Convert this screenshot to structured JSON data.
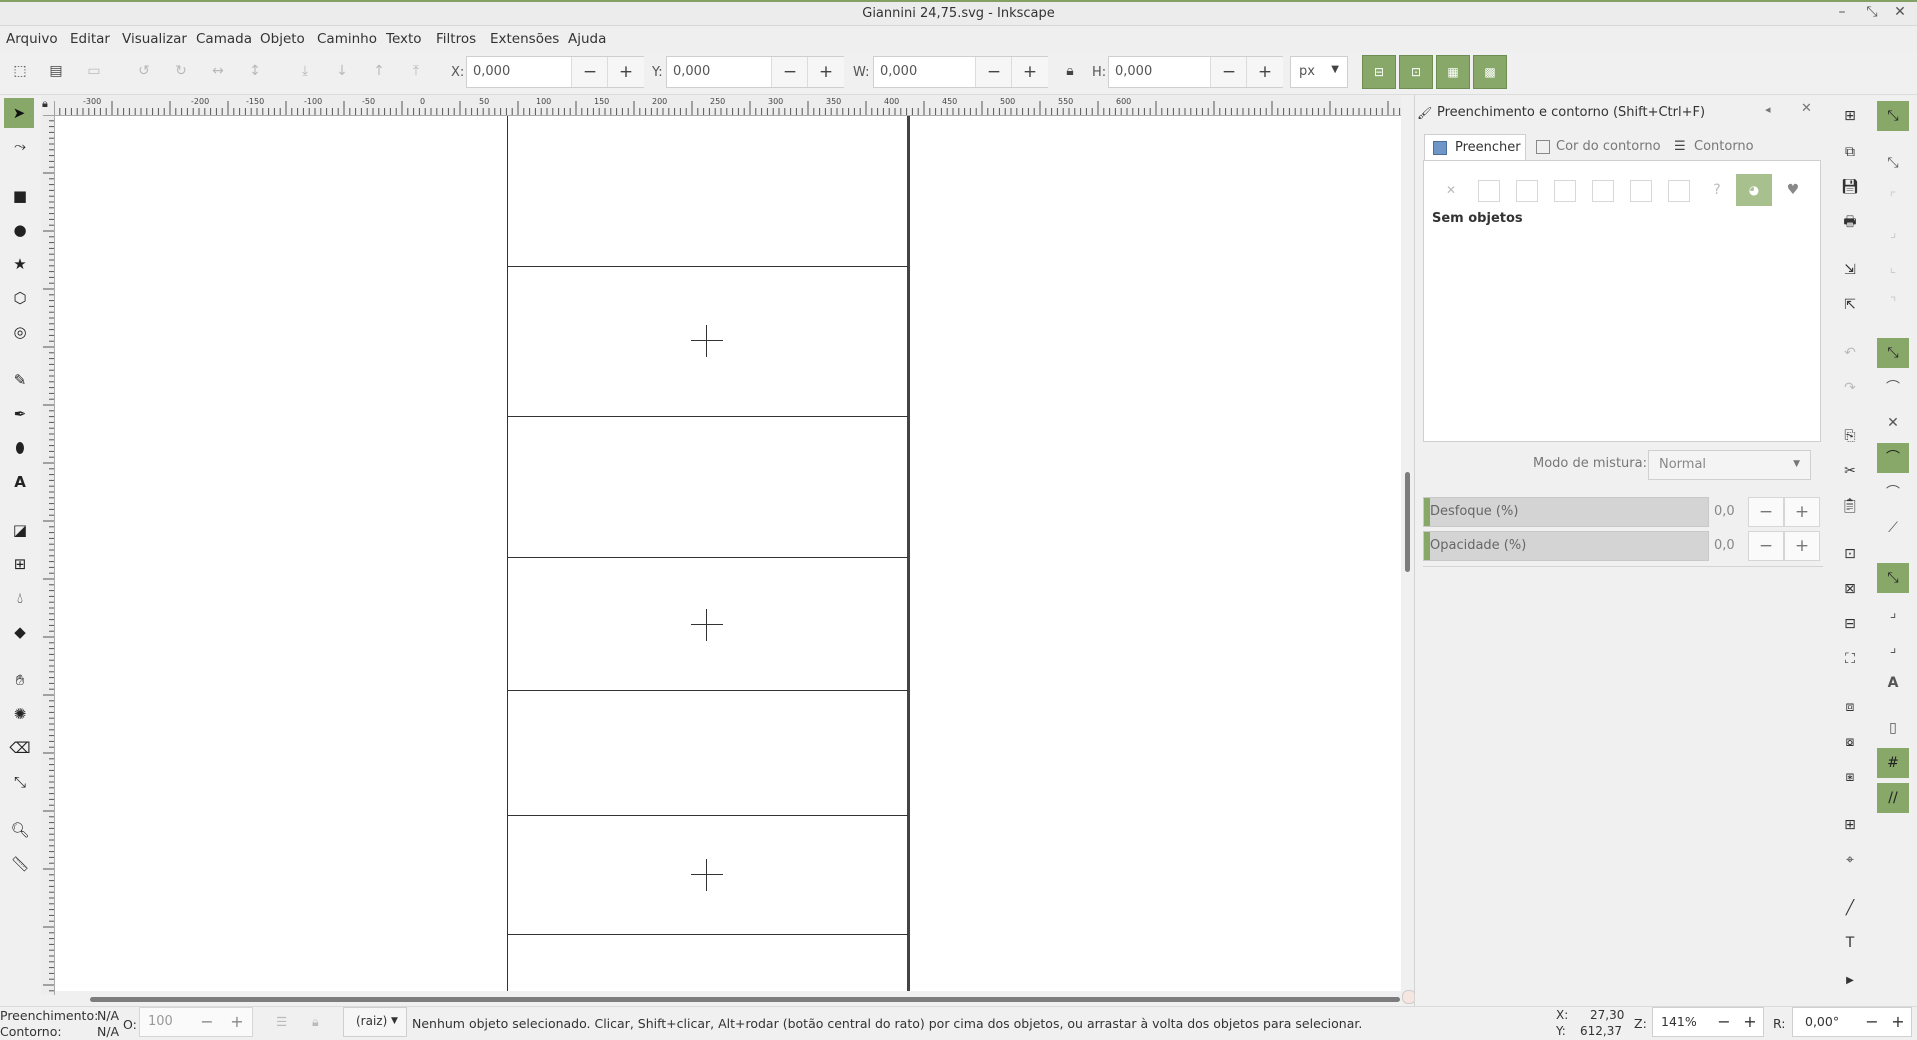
{
  "window": {
    "title": "Giannini 24,75.svg - Inkscape"
  },
  "menu": [
    "Arquivo",
    "Editar",
    "Visualizar",
    "Camada",
    "Objeto",
    "Caminho",
    "Texto",
    "Filtros",
    "Extensões",
    "Ajuda"
  ],
  "toolbar": {
    "x_label": "X:",
    "x_value": "0,000",
    "y_label": "Y:",
    "y_value": "0,000",
    "w_label": "W:",
    "w_value": "0,000",
    "h_label": "H:",
    "h_value": "0,000",
    "unit": "px",
    "minus": "−",
    "plus": "+"
  },
  "ruler": {
    "h_labels": [
      "-300",
      "-200",
      "-150",
      "-100",
      "-50",
      "0",
      "50",
      "100",
      "150",
      "200",
      "250",
      "300",
      "350",
      "400",
      "450",
      "500",
      "550",
      "600"
    ]
  },
  "dock": {
    "title": "Preenchimento e contorno (Shift+Ctrl+F)",
    "tabs": [
      "Preencher",
      "Cor do contorno",
      "Contorno"
    ],
    "no_objects": "Sem objetos",
    "blend_label": "Modo de mistura:",
    "blend_value": "Normal",
    "blur_label": "Desfoque (%)",
    "blur_value": "0,0",
    "opacity_label": "Opacidade (%)",
    "opacity_value": "0,0"
  },
  "status": {
    "fill_label": "Preenchimento:",
    "fill_value": "N/A",
    "stroke_label": "Contorno:",
    "stroke_value": "N/A",
    "o_label": "O:",
    "o_value": "100",
    "layer": "(raiz)",
    "message": "Nenhum objeto selecionado. Clicar, Shift+clicar, Alt+rodar (botão central do rato) por cima dos objetos, ou arrastar à volta dos objetos para selecionar.",
    "cx_label": "X:",
    "cx_value": "27,30",
    "cy_label": "Y:",
    "cy_value": "612,37",
    "zoom_label": "Z:",
    "zoom_value": "141%",
    "rot_label": "R:",
    "rot_value": "0,00°"
  },
  "colors": {
    "accent": "#88a86a",
    "canvas": "#ffffff",
    "chrome": "#f0f0f0"
  }
}
